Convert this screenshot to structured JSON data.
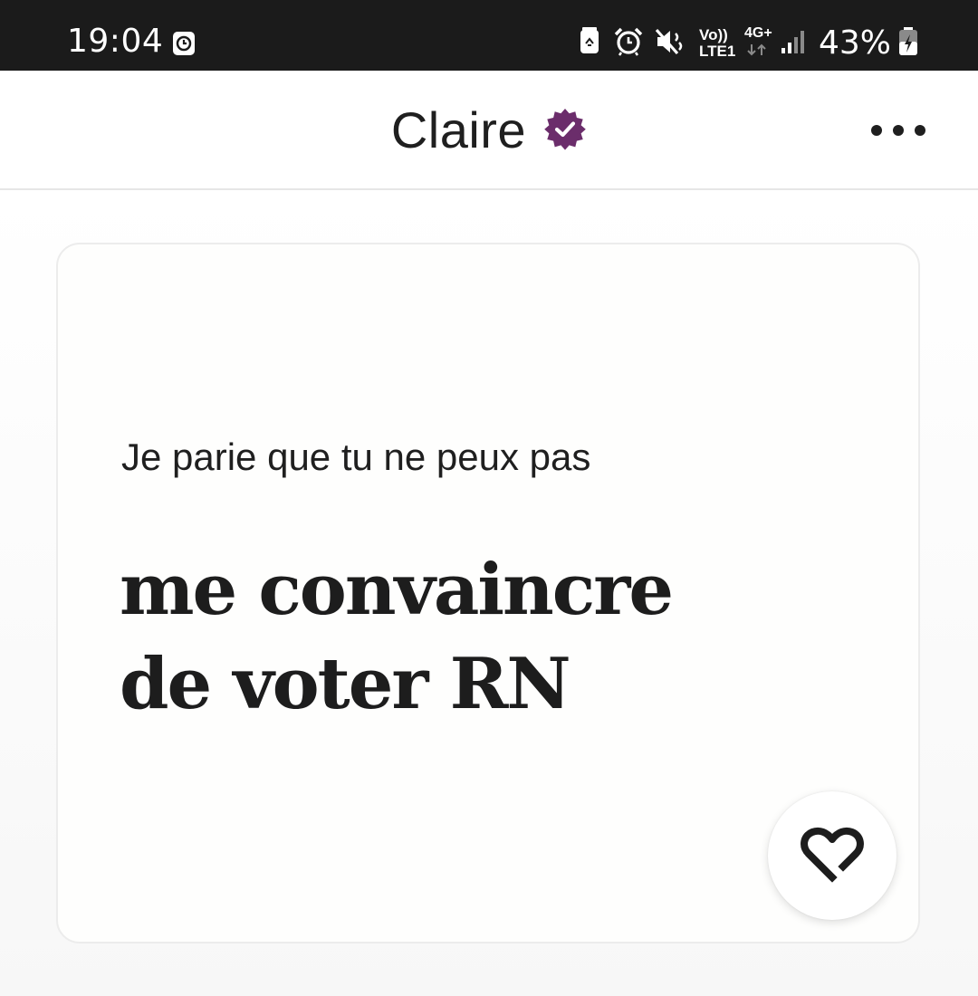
{
  "status_bar": {
    "time": "19:04",
    "volte": "Vo))",
    "lte": "LTE1",
    "network": "4G+",
    "battery_percent": "43%",
    "icons": [
      "clock-app-icon",
      "battery-saver-icon",
      "alarm-icon",
      "mute-icon",
      "volte-icon",
      "data-arrows-icon",
      "signal-icon",
      "battery-charging-icon"
    ]
  },
  "header": {
    "title": "Claire",
    "verified_icon": "verified-badge-icon",
    "menu_icon": "more-options-icon"
  },
  "prompt": {
    "question": "Je parie que tu ne peux pas",
    "answer": "me convaincre\nde voter RN",
    "like_icon": "heart-icon"
  },
  "colors": {
    "status_bar_bg": "#1b1b1b",
    "verified_badge": "#6b2d6b",
    "text": "#1f1f1f"
  }
}
